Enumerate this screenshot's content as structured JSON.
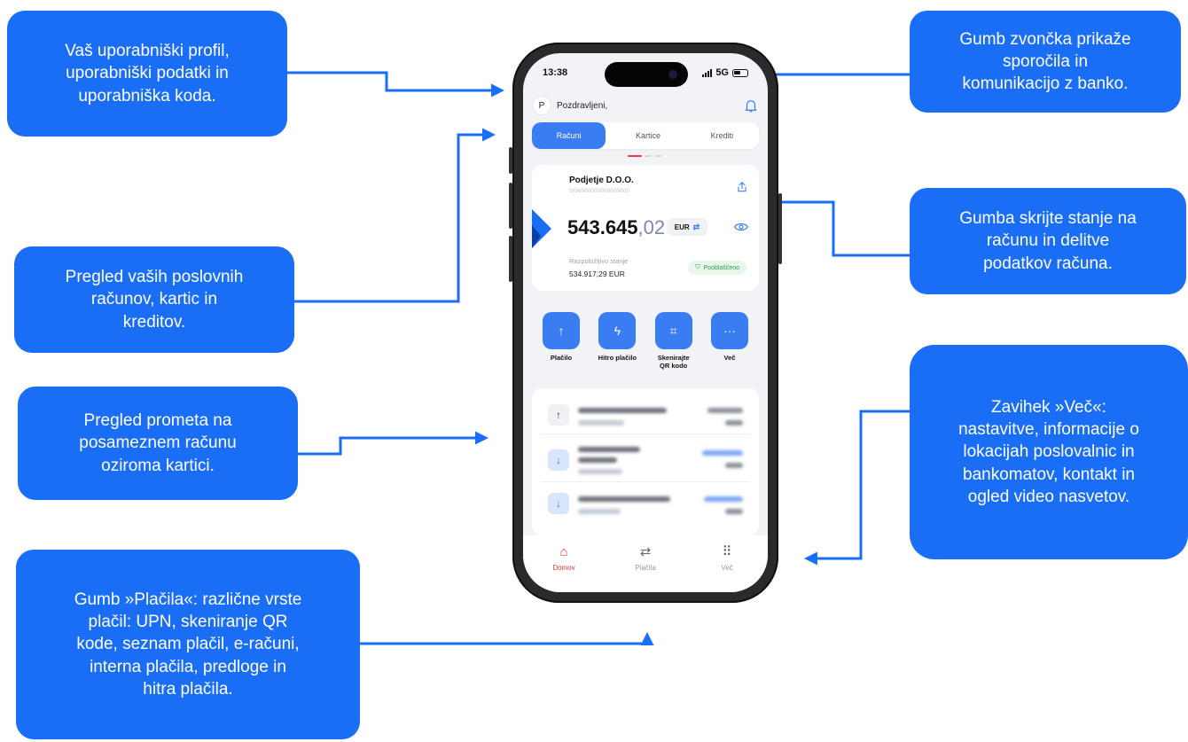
{
  "callouts": {
    "profile": "Vaš uporabniški profil,\nuporabniški podatki in\nuporabniška koda.",
    "accounts": "Pregled vaših poslovnih\nračunov, kartic in\nkreditov.",
    "transactions": "Pregled prometa na\nposameznem računu\noziroma kartici.",
    "payments": "Gumb »Plačila«: različne vrste\nplačil: UPN, skeniranje QR\nkode, seznam plačil,  e-računi,\ninterna plačila, predloge in\nhitra plačila.",
    "bell": "Gumb zvončka prikaže\nsporočila in\nkomunikacijo z banko.",
    "hide_share": "Gumba skrijte stanje na\nračunu in delitve\npodatkov računa.",
    "more": "Zavihek »Več«:\nnastavitve, informacije o\nlokacijah poslovalnic in\nbankomatov, kontakt in\nogled video nasvetov."
  },
  "status": {
    "time": "13:38",
    "network": "5G"
  },
  "header": {
    "avatar": "P",
    "greeting": "Pozdravljeni,"
  },
  "tabs": [
    {
      "label": "Računi",
      "active": true
    },
    {
      "label": "Kartice",
      "active": false
    },
    {
      "label": "Krediti",
      "active": false
    }
  ],
  "account": {
    "name": "Podjetje D.O.O.",
    "iban": "SI56000000000000000",
    "balance_int": "543.645",
    "balance_dec": ",02",
    "currency": "EUR",
    "available_label": "Razpoložljivo stanje",
    "available_value": "534.917,29 EUR",
    "badge": "Pooblaščeno"
  },
  "actions": [
    {
      "label": "Plačilo",
      "icon": "arrow-up-icon"
    },
    {
      "label": "Hitro plačilo",
      "icon": "lightning-icon"
    },
    {
      "label": "Skenirajte\nQR kodo",
      "icon": "qr-scan-icon"
    },
    {
      "label": "Več",
      "icon": "more-dots-icon"
    }
  ],
  "nav": [
    {
      "label": "Domov",
      "icon": "home-icon",
      "active": true
    },
    {
      "label": "Plačila",
      "icon": "transfer-icon",
      "active": false
    },
    {
      "label": "Več",
      "icon": "grid-icon",
      "active": false
    }
  ],
  "colors": {
    "accent": "#1a6ef5",
    "button": "#3a7cf2",
    "active_nav": "#e53b3b",
    "badge": "#2a9a4f"
  }
}
